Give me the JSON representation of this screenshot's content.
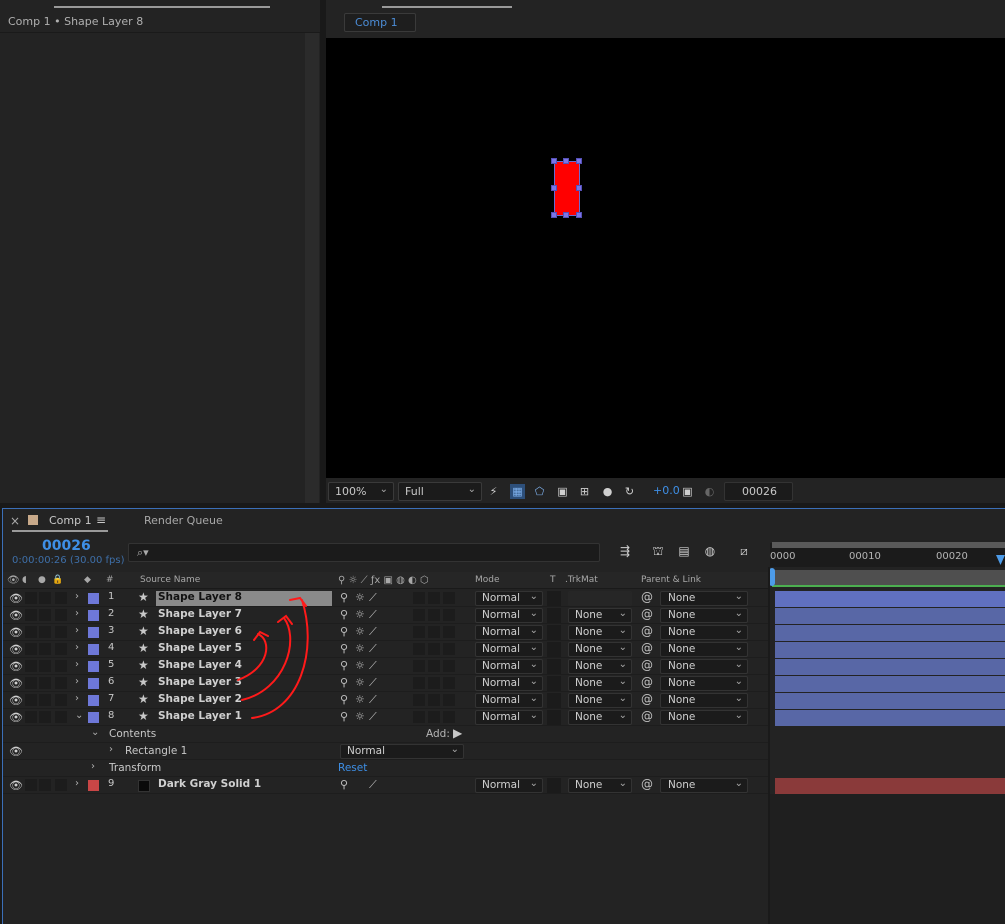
{
  "effect_controls": {
    "subtitle": "Comp 1 • Shape Layer 8"
  },
  "composition": {
    "subtab": "Comp 1"
  },
  "viewer_toolbar": {
    "zoom": "100%",
    "resolution": "Full",
    "exposure": "+0.0",
    "current_time": "00026"
  },
  "timeline": {
    "tab_label": "Comp 1",
    "render_queue": "Render Queue",
    "timecode": "00026",
    "subtime": "0:00:00:26 (30.00 fps)",
    "search_placeholder": "⌕▾",
    "ruler": [
      "0000",
      "00010",
      "00020"
    ],
    "columns": {
      "hash": "#",
      "source_name": "Source Name",
      "mode": "Mode",
      "t": "T",
      "trkmat": ".TrkMat",
      "parent": "Parent & Link"
    },
    "layers": [
      {
        "num": "1",
        "name": "Shape Layer 8",
        "mode": "Normal",
        "trkmat": "",
        "parent": "None",
        "color": "#6e78d8"
      },
      {
        "num": "2",
        "name": "Shape Layer 7",
        "mode": "Normal",
        "trkmat": "None",
        "parent": "None",
        "color": "#6e78d8"
      },
      {
        "num": "3",
        "name": "Shape Layer 6",
        "mode": "Normal",
        "trkmat": "None",
        "parent": "None",
        "color": "#6e78d8"
      },
      {
        "num": "4",
        "name": "Shape Layer 5",
        "mode": "Normal",
        "trkmat": "None",
        "parent": "None",
        "color": "#6e78d8"
      },
      {
        "num": "5",
        "name": "Shape Layer 4",
        "mode": "Normal",
        "trkmat": "None",
        "parent": "None",
        "color": "#6e78d8"
      },
      {
        "num": "6",
        "name": "Shape Layer 3",
        "mode": "Normal",
        "trkmat": "None",
        "parent": "None",
        "color": "#6e78d8"
      },
      {
        "num": "7",
        "name": "Shape Layer 2",
        "mode": "Normal",
        "trkmat": "None",
        "parent": "None",
        "color": "#6e78d8"
      },
      {
        "num": "8",
        "name": "Shape Layer 1",
        "mode": "Normal",
        "trkmat": "None",
        "parent": "None",
        "color": "#6e78d8"
      }
    ],
    "contents_label": "Contents",
    "add_label": "Add:",
    "rectangle_label": "Rectangle 1",
    "rectangle_mode": "Normal",
    "transform_label": "Transform",
    "reset_label": "Reset",
    "solid_layer": {
      "num": "9",
      "name": "Dark Gray Solid 1",
      "mode": "Normal",
      "trkmat": "None",
      "parent": "None",
      "color": "#c94646"
    }
  }
}
